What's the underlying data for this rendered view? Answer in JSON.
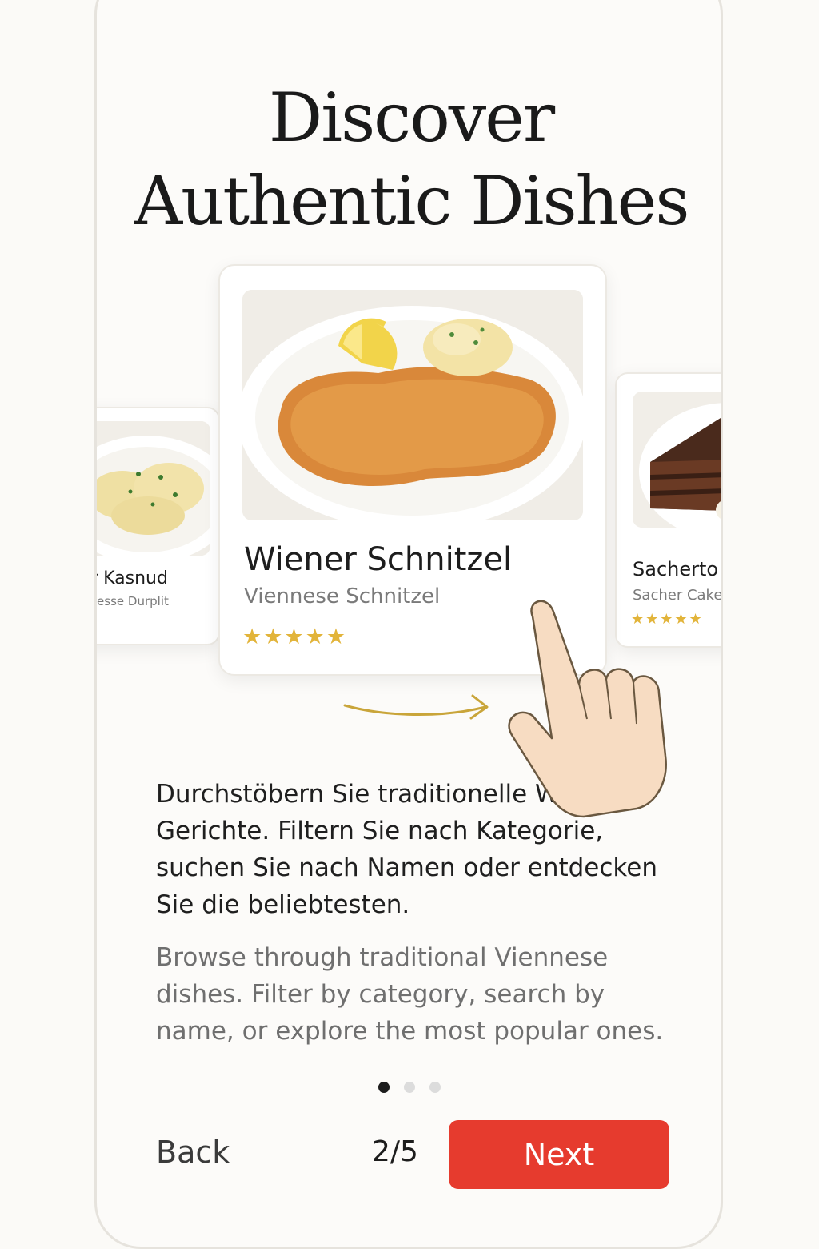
{
  "title": {
    "line1": "Discover",
    "line2": "Authentic Dishes"
  },
  "carousel": {
    "left_card": {
      "name": "ntner Kasnud",
      "subtitle": "man Chesse Durplit",
      "stars": "★★★",
      "photo_icon": "dumplings-image"
    },
    "center_card": {
      "name": "Wiener Schnitzel",
      "subtitle": "Viennese Schnitzel",
      "stars": "★★★★★",
      "photo_icon": "schnitzel-image"
    },
    "right_card": {
      "name": "Sacherto",
      "subtitle": "Sacher Cake",
      "stars": "★★★★★",
      "photo_icon": "sacher-cake-image"
    }
  },
  "gesture": {
    "hand_icon": "swipe-hand-icon",
    "arrow_icon": "swipe-arrow-icon"
  },
  "description": {
    "german": "Durchstöbern Sie traditionelle Wiener Gerichte. Filtern Sie nach Kategorie, suchen Sie nach Namen oder entdecken Sie die beliebtesten.",
    "english": "Browse through traditional Viennese dishes. Filter by category, search by name, or explore the most popular ones."
  },
  "pagination": {
    "dots": 3,
    "active_index": 0
  },
  "footer": {
    "back_label": "Back",
    "counter": "2/5",
    "next_label": "Next"
  },
  "colors": {
    "accent": "#e63b2e",
    "star": "#e2b43a",
    "background": "#fbfaf7"
  }
}
